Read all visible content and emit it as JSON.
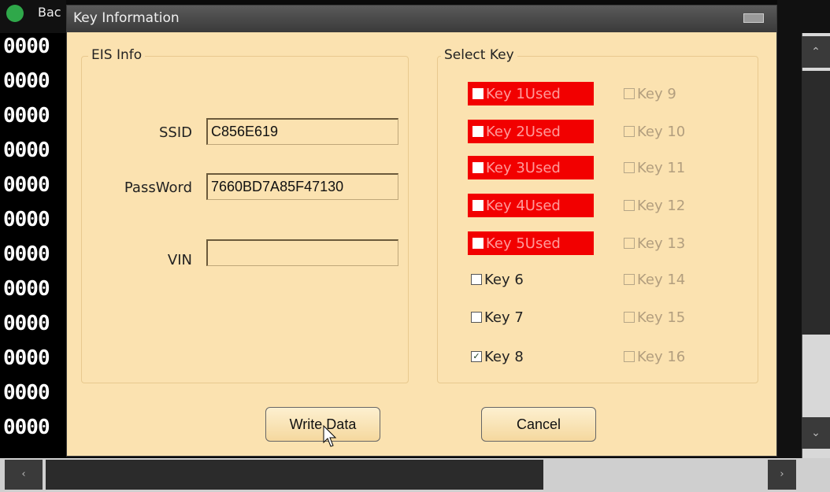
{
  "background_app": {
    "title_fragment": "Bac",
    "hex_rows": [
      "0000",
      "0000",
      "0000",
      "0000",
      "0000",
      "0000",
      "0000",
      "0000",
      "0000",
      "0000",
      "0000",
      "0000"
    ]
  },
  "dialog": {
    "title": "Key Information",
    "eis": {
      "group_label": "EIS Info",
      "ssid_label": "SSID",
      "ssid_value": "C856E619",
      "password_label": "PassWord",
      "password_value": "7660BD7A85F47130",
      "vin_label": "VIN",
      "vin_value": ""
    },
    "select": {
      "group_label": "Select Key",
      "left_keys": [
        {
          "label": "Key 1Used",
          "state": "used"
        },
        {
          "label": "Key 2Used",
          "state": "used"
        },
        {
          "label": "Key 3Used",
          "state": "used"
        },
        {
          "label": "Key 4Used",
          "state": "used"
        },
        {
          "label": "Key 5Used",
          "state": "used"
        },
        {
          "label": "Key 6",
          "state": "unchecked"
        },
        {
          "label": "Key 7",
          "state": "unchecked"
        },
        {
          "label": "Key 8",
          "state": "checked"
        }
      ],
      "right_keys": [
        {
          "label": "Key 9",
          "state": "disabled"
        },
        {
          "label": "Key 10",
          "state": "disabled"
        },
        {
          "label": "Key 11",
          "state": "disabled"
        },
        {
          "label": "Key 12",
          "state": "disabled"
        },
        {
          "label": "Key 13",
          "state": "disabled"
        },
        {
          "label": "Key 14",
          "state": "disabled"
        },
        {
          "label": "Key 15",
          "state": "disabled"
        },
        {
          "label": "Key 16",
          "state": "disabled"
        }
      ]
    },
    "buttons": {
      "write": "Write Data",
      "cancel": "Cancel"
    }
  },
  "colors": {
    "dialog_bg": "#fbe2b0",
    "used_key": "#f20000"
  },
  "icons": {
    "checkbox_checked": "☑",
    "checkmark": "✓"
  }
}
